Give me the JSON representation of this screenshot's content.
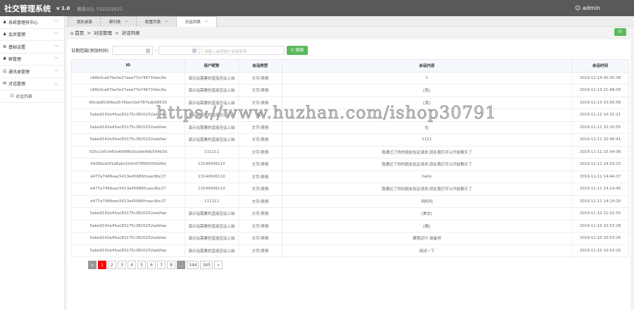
{
  "header": {
    "title": "社交管理系统",
    "version": "v 1.0",
    "contact": "联系QQ: 532222521",
    "user": "admin"
  },
  "sidebar": {
    "items": [
      {
        "label": "系统管理员中心",
        "icon": "user-icon"
      },
      {
        "label": "会员管理",
        "icon": "user-icon"
      },
      {
        "label": "基础设置",
        "icon": "gear-icon"
      },
      {
        "label": "群管理",
        "icon": "group-icon"
      },
      {
        "label": "通讯录管理",
        "icon": "contacts-icon"
      },
      {
        "label": "对话管理",
        "icon": "chat-icon"
      }
    ],
    "sub_item": "对话列表"
  },
  "tabs": [
    {
      "label": "我的桌面"
    },
    {
      "label": "群列表"
    },
    {
      "label": "配置列表"
    },
    {
      "label": "对话列表"
    }
  ],
  "breadcrumb": {
    "home": "首页",
    "sep": ">",
    "level1": "对话管理",
    "level2": "对话列表"
  },
  "filter": {
    "label": "日期范围(添加时间):",
    "dash": "-",
    "placeholder": "请输入会员账户或者昵称",
    "search": "搜索"
  },
  "table": {
    "headers": [
      "ID",
      "用户昵称",
      "会话类型",
      "会话内容",
      "会话时间"
    ],
    "rows": [
      [
        "c66b0ca67be3e27aee77e74671fdec9a",
        "演示站需要的直接压站上拍",
        "文字/表情",
        "1",
        "2019-11-14 00:35:38"
      ],
      [
        "c66b0ca67be3e27aee77e74671fdec9a",
        "演示站需要的直接压站上拍",
        "文字/表情",
        "[笑]",
        "2019-11-13 21:48:00"
      ],
      [
        "80cde8290bed576bec0a0787edb08530",
        "演示站需要的直接压站上拍",
        "文字/表情",
        "[哭]",
        "2019-11-13 20:56:58"
      ],
      [
        "5abe9142e45ac83175c3820252aebfae",
        "演示站需要的直接压站上拍",
        "图片",
        "",
        "2019-11-12 10:31:11"
      ],
      [
        "5abe9142e45ac83175c3820252aebfae",
        "演示站需要的直接压站上拍",
        "文字/表情",
        "在",
        "2019-11-12 10:30:55"
      ],
      [
        "5abe9142e45ac83175c3820252aebfae",
        "演示站需要的直接压站上拍",
        "文字/表情",
        "1111",
        "2019-11-11 20:48:41"
      ],
      [
        "025c2d5c945e49986d3cb9e99b50403d",
        "111111",
        "文字/表情",
        "我通过了你的朋友验证请求,现在我们可以开始聊天了",
        "2019-11-11 15:04:06"
      ],
      [
        "0426bcb0f1d6abc50dc67f890505b06d",
        "13144506110",
        "文字/表情",
        "我通过了你的朋友验证请求,现在我们可以开始聊天了",
        "2019-11-11 14:59:15"
      ],
      [
        "e477a7466eac5413e45686fcaac9bc27",
        "13144506110",
        "文字/表情",
        "hello",
        "2019-11-11 14:44:37"
      ],
      [
        "e477a7466eac5413e45686fcaac9bc27",
        "13144506110",
        "文字/表情",
        "我通过了你的朋友验证请求,现在我们可以开始聊天了",
        "2019-11-11 14:14:40"
      ],
      [
        "e477a7466eac5413e45686fcaac9bc27",
        "111111",
        "文字/表情",
        "呵呵呵",
        "2019-11-11 14:14:20"
      ],
      [
        "5abe9142e45ac83175c3820252aebfae",
        "演示站需要的直接压站上拍",
        "文字/表情",
        "[美女]",
        "2019-11-10 11:21:55"
      ],
      [
        "5abe9142e45ac83175c3820252aebfae",
        "演示站需要的直接压站上拍",
        "文字/表情",
        "[酷]",
        "2019-11-10 10:53:28"
      ],
      [
        "5abe9142e45ac83175c3820252aebfae",
        "演示站需要的直接压站上拍",
        "文字/表情",
        "哪我还行 准备吧",
        "2019-11-10 10:53:26"
      ],
      [
        "5abe9142e45ac83175c3820252aebfae",
        "演示站需要的直接压站上拍",
        "文字/表情",
        "测试一下",
        "2019-11-10 10:53:20"
      ]
    ]
  },
  "pagination": {
    "prev": "«",
    "pages": [
      "1",
      "2",
      "3",
      "4",
      "5",
      "6",
      "7",
      "8"
    ],
    "ellipsis": "...",
    "last_pages": [
      "344",
      "345"
    ],
    "next": "»",
    "current": "1"
  },
  "watermark": "https://www.huzhan.com/ishop30791"
}
